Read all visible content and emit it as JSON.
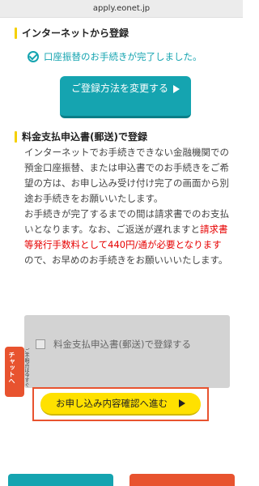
{
  "browser": {
    "url": "apply.eonet.jp"
  },
  "internet_section": {
    "title": "インターネットから登録",
    "notice": "口座振替のお手続きが完了しました。",
    "change_button_label": "ご登録方法を変更する"
  },
  "mail_section": {
    "title": "料金支払申込書(郵送)で登録",
    "paragraph1": "インターネットでお手続きできない金融機関での預金口座振替、または申込書でのお手続きをご希望の方は、お申し込み受け付け完了の画面から別途お手続きをお願いいたします。",
    "p2_part1": "お手続きが完了するまでの間は請求書でのお支払いとなります。なお、ご返送が遅れますと",
    "p2_red": "請求書等発行手数料として440円/通が必要となります",
    "p2_part2": "ので、お早めのお手続きをお願いいいたします。",
    "checkbox_label": "料金支払申込書(郵送)で登録する",
    "checkbox_checked": false
  },
  "chat": {
    "label": "チャットへ",
    "note": "ご不明点は今すぐ"
  },
  "next_button_label": "お申し込み内容確認へ進む",
  "colors": {
    "teal": "#15a4b0",
    "yellow": "#ffe100",
    "orange": "#e8532f",
    "red": "#e60000"
  }
}
